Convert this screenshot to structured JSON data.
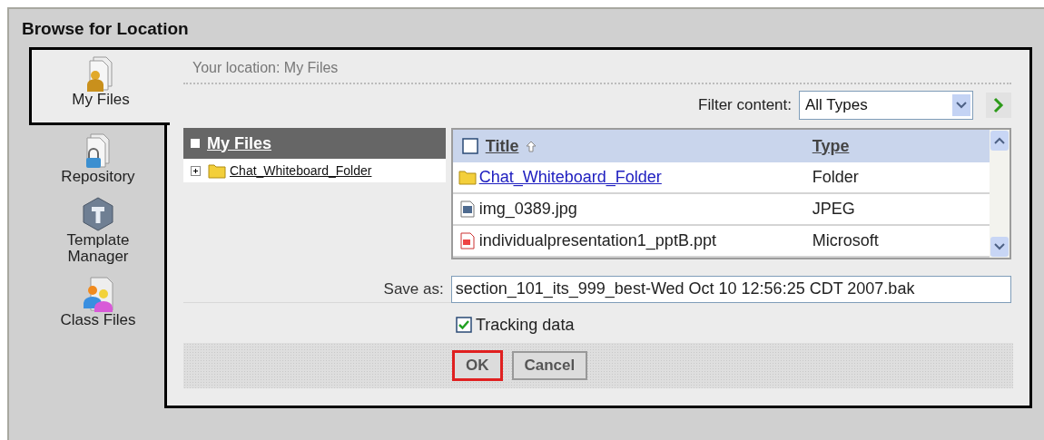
{
  "window": {
    "title": "Browse for Location"
  },
  "sidebar": {
    "items": [
      {
        "label": "My Files",
        "kind": "user",
        "selected": true
      },
      {
        "label": "Repository",
        "kind": "lock",
        "selected": false
      },
      {
        "label": "Template Manager",
        "kind": "template",
        "selected": false
      },
      {
        "label": "Class Files",
        "kind": "group",
        "selected": false
      }
    ]
  },
  "location": "Your location: My Files",
  "filter": {
    "label": "Filter content:",
    "value": "All Types"
  },
  "tree": {
    "root": "My Files",
    "children": [
      {
        "label": "Chat_Whiteboard_Folder",
        "expanded": false
      }
    ]
  },
  "file_list": {
    "select_all": {
      "checked": false
    },
    "columns": [
      "Title",
      "Type"
    ],
    "rows": [
      {
        "kind": "folder",
        "title": "Chat_Whiteboard_Folder",
        "type": "Folder"
      },
      {
        "kind": "image",
        "title": "img_0389.jpg",
        "type": "JPEG"
      },
      {
        "kind": "document",
        "title": "individualpresentation1_pptB.ppt",
        "type": "Microsoft"
      }
    ]
  },
  "save_as": {
    "label": "Save as:",
    "value": "section_101_its_999_best-Wed Oct 10 12:56:25 CDT 2007.bak"
  },
  "tracking": {
    "label": "Tracking data",
    "checked": true
  },
  "buttons": [
    {
      "label": "OK",
      "focused": true
    },
    {
      "label": "Cancel",
      "focused": false
    }
  ]
}
